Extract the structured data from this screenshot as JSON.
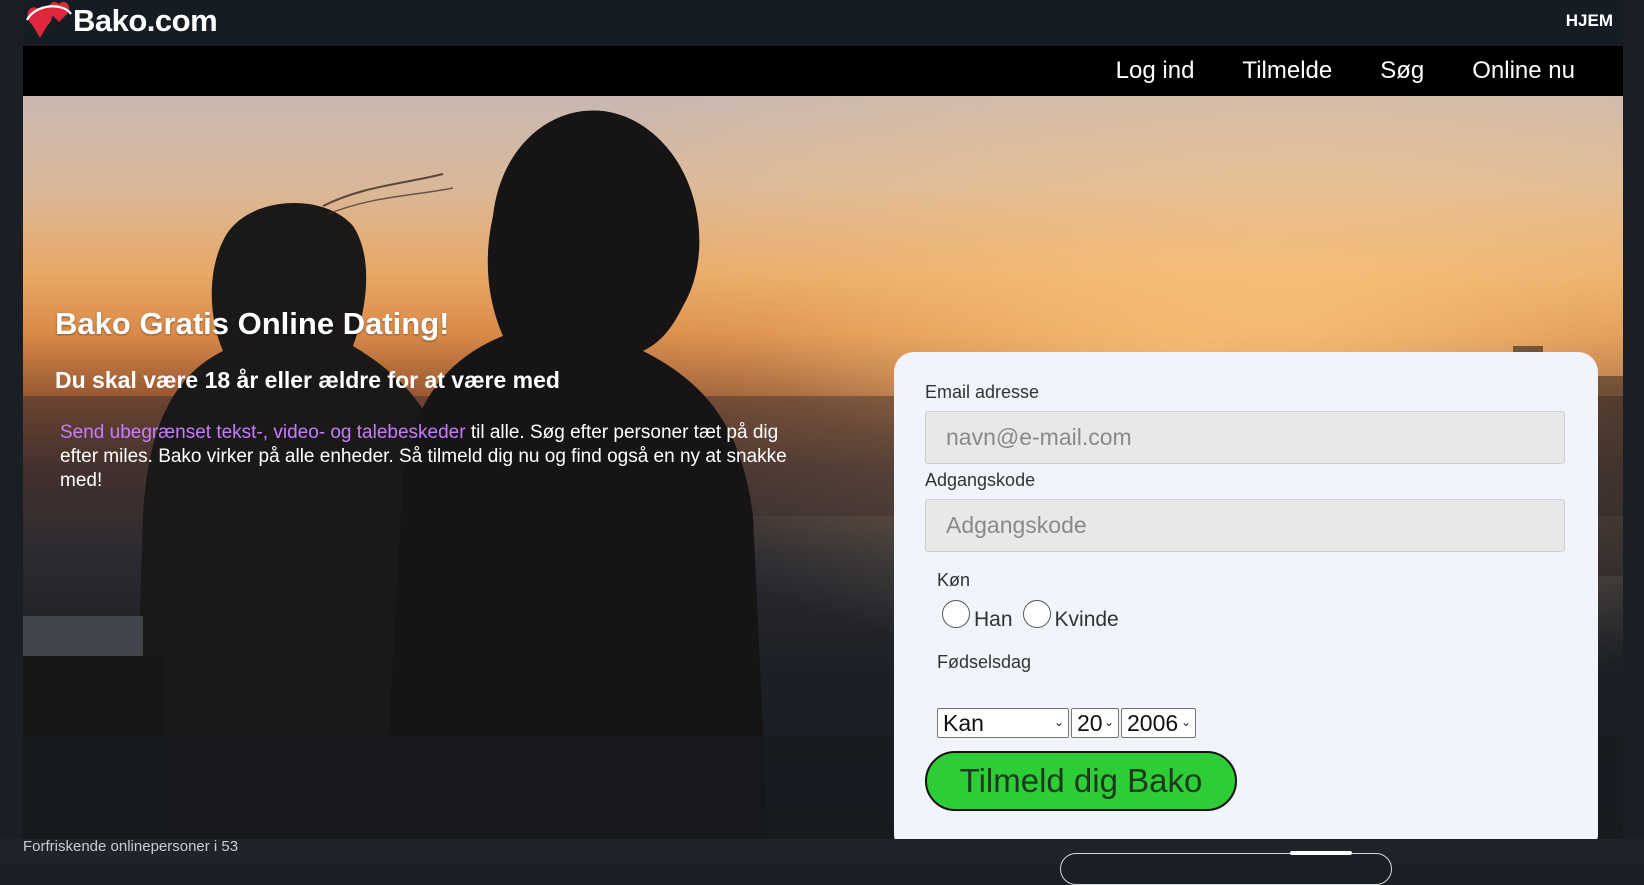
{
  "header": {
    "logo_text": "Bako.com",
    "home_link": "HJEM"
  },
  "nav": {
    "items": [
      "Log ind",
      "Tilmelde",
      "Søg",
      "Online nu"
    ]
  },
  "hero": {
    "title": "Bako Gratis Online Dating!",
    "subtitle": "Du skal være 18 år eller ældre for at være med",
    "body_highlight": "Send ubegrænset tekst-, video- og talebeskeder",
    "body_rest": " til alle. Søg efter personer tæt på dig efter miles. Bako virker på alle enheder. Så tilmeld dig nu og find også en ny at snakke med!"
  },
  "form": {
    "email_label": "Email adresse",
    "email_placeholder": "navn@e-mail.com",
    "password_label": "Adgangskode",
    "password_placeholder": "Adgangskode",
    "gender_label": "Køn",
    "gender_options": [
      "Han",
      "Kvinde"
    ],
    "birthday_label": "Fødselsdag",
    "birth_month": "Kan",
    "birth_day": "20",
    "birth_year": "2006",
    "submit_label": "Tilmeld dig Bako"
  },
  "footer": {
    "online_text": "Forfriskende onlinepersoner i 53"
  },
  "colors": {
    "accent_green": "#2ecc37",
    "highlight_purple": "#c77dff",
    "logo_heart_red": "#e0263c",
    "nav_bg": "#000000",
    "page_bg": "#1a1f26"
  }
}
